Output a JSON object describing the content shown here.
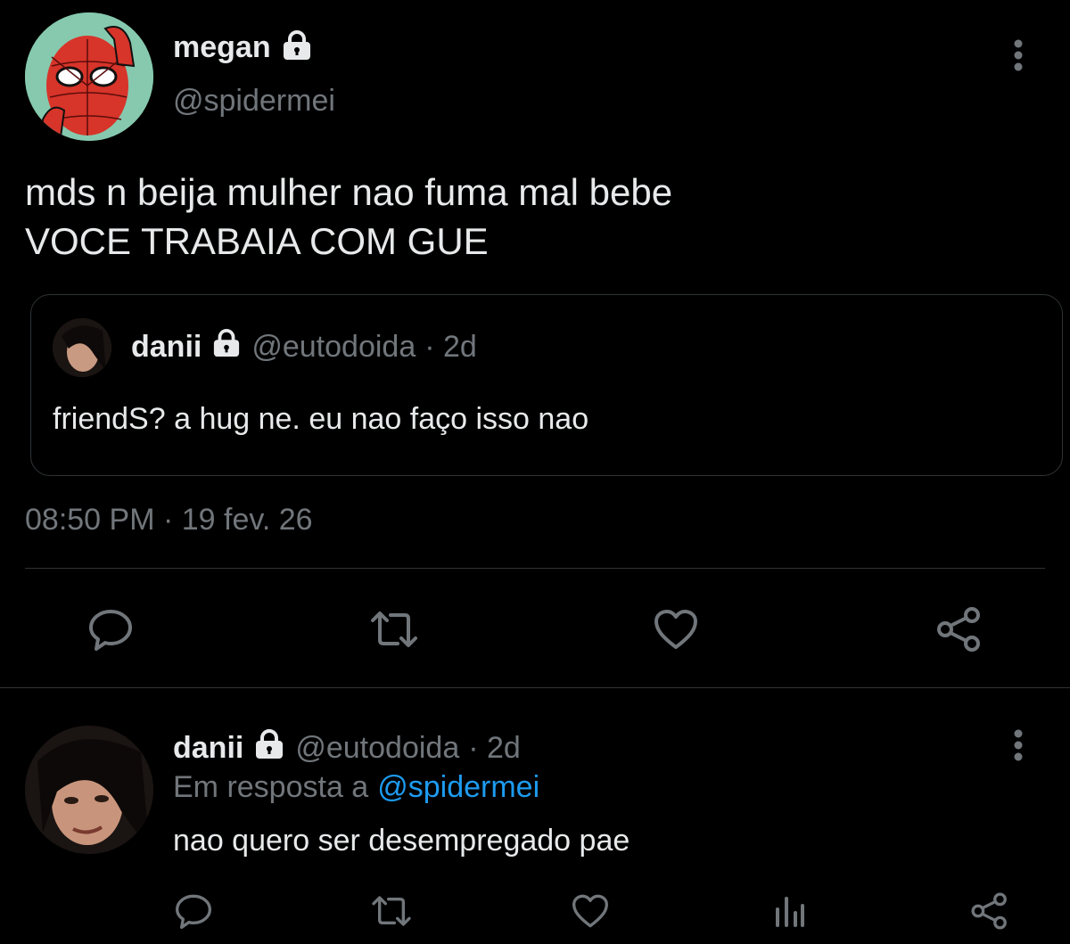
{
  "tweet": {
    "author_name": "megan",
    "author_handle": "@spidermei",
    "text_line1": "mds n beija mulher nao fuma mal bebe",
    "text_line2": "VOCE TRABAIA COM GUE",
    "timestamp": "08:50 PM · 19 fev. 26"
  },
  "quoted": {
    "author_name": "danii",
    "author_handle": "@eutodoida",
    "age": "· 2d",
    "text": "friendS? a hug ne. eu nao faço isso nao"
  },
  "reply": {
    "author_name": "danii",
    "author_handle": "@eutodoida",
    "age": "· 2d",
    "reply_prefix": "Em resposta a",
    "reply_to": "@spidermei",
    "text": "nao quero ser desempregado pae"
  },
  "icons": {
    "locked": "lock-icon",
    "more": "more-vertical-icon",
    "reply": "reply-icon",
    "retweet": "retweet-icon",
    "like": "heart-icon",
    "share": "share-icon",
    "analytics": "analytics-icon"
  },
  "colors": {
    "background": "#000000",
    "primary_text": "#e7e9ea",
    "secondary_text": "#71767b",
    "link": "#1d9bf0",
    "border": "#2f3336"
  }
}
